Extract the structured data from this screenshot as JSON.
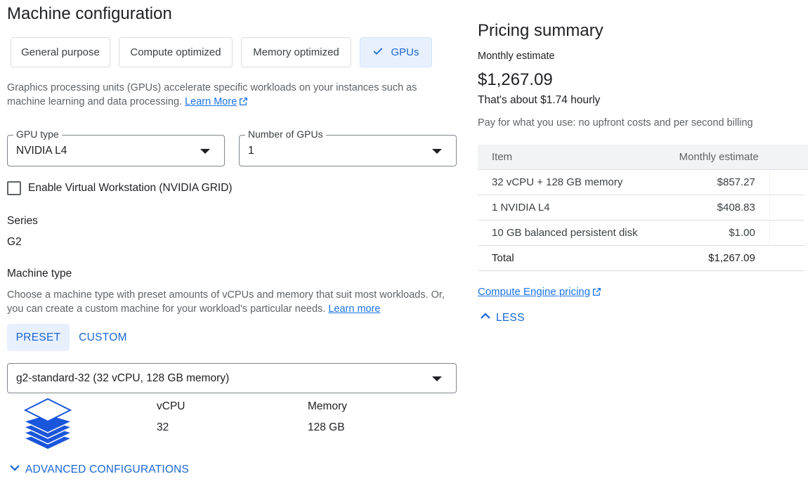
{
  "machine_config": {
    "title": "Machine configuration",
    "family_tabs": [
      {
        "label": "General purpose"
      },
      {
        "label": "Compute optimized"
      },
      {
        "label": "Memory optimized"
      },
      {
        "label": "GPUs"
      }
    ],
    "gpu_description": "Graphics processing units (GPUs) accelerate specific workloads on your instances such as machine learning and data processing.",
    "gpu_learn_more": "Learn More",
    "gpu_type": {
      "label": "GPU type",
      "value": "NVIDIA L4"
    },
    "gpu_count": {
      "label": "Number of GPUs",
      "value": "1"
    },
    "virtual_workstation_label": "Enable Virtual Workstation (NVIDIA GRID)",
    "series": {
      "label": "Series",
      "value": "G2"
    },
    "machine_type": {
      "label": "Machine type",
      "description": "Choose a machine type with preset amounts of vCPUs and memory that suit most workloads. Or, you can create a custom machine for your workload's particular needs.",
      "learn_more": "Learn more",
      "tabs": [
        {
          "label": "PRESET"
        },
        {
          "label": "CUSTOM"
        }
      ],
      "selected": "g2-standard-32 (32 vCPU, 128 GB memory)"
    },
    "specs": {
      "vcpu_label": "vCPU",
      "vcpu_value": "32",
      "memory_label": "Memory",
      "memory_value": "128 GB"
    },
    "advanced_label": "ADVANCED CONFIGURATIONS"
  },
  "pricing": {
    "title": "Pricing summary",
    "subtitle": "Monthly estimate",
    "amount": "$1,267.09",
    "hourly": "That's about $1.74 hourly",
    "note": "Pay for what you use: no upfront costs and per second billing",
    "table": {
      "headers": [
        "Item",
        "Monthly estimate"
      ],
      "rows": [
        {
          "item": "32 vCPU + 128 GB memory",
          "cost": "$857.27"
        },
        {
          "item": "1 NVIDIA L4",
          "cost": "$408.83"
        },
        {
          "item": "10 GB balanced persistent disk",
          "cost": "$1.00"
        }
      ],
      "total": {
        "item": "Total",
        "cost": "$1,267.09"
      }
    },
    "engine_link": "Compute Engine pricing",
    "less_label": "LESS"
  },
  "icons": {
    "check": "check-icon",
    "external": "external-link-icon",
    "dropdown": "dropdown-caret-icon",
    "stack": "machine-stack-icon",
    "chevron_down": "chevron-down-icon",
    "chevron_up": "chevron-up-icon"
  },
  "colors": {
    "accent": "#1967d2",
    "link": "#1a73e8",
    "active_tab_bg": "#e8f0fe",
    "stack_icon": "#1a56db"
  }
}
